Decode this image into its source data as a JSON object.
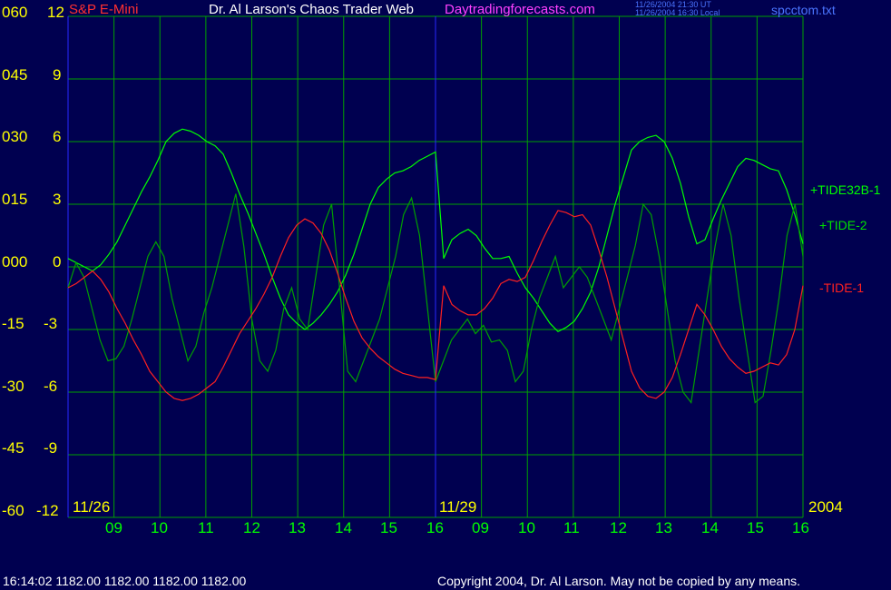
{
  "header": {
    "instrument": "S&P E-Mini",
    "site": "Dr. Al Larson's Chaos Trader Web",
    "domain": "Daytradingforecasts.com",
    "stamp_line1": "11/26/2004 21:30 UT",
    "stamp_line2": "11/26/2004 16:30 Local",
    "file": "spcctom.txt"
  },
  "footer": {
    "quote": "16:14:02  1182.00 1182.00 1182.00 1182.00",
    "copyright": "Copyright 2004, Dr. Al Larson. May not be copied by any means."
  },
  "colors": {
    "background": "#000050",
    "grid": "#00a000",
    "divider": "#2828ff",
    "axis_text": "#ffff00",
    "tide32b": "#00ff00",
    "tide2": "#00a000",
    "tide1": "#ff2020",
    "instrument": "#ff3030",
    "domain": "#ff40ff"
  },
  "chart_data": {
    "type": "line",
    "title": "S&P E-Mini",
    "left_axis": {
      "ticks": [
        "060",
        "045",
        "030",
        "015",
        "000",
        "-15",
        "-30",
        "-45",
        "-60"
      ],
      "ylim": [
        -60,
        60
      ]
    },
    "right_axis": {
      "ticks": [
        "12",
        "9",
        "6",
        "3",
        "0",
        "-3",
        "-6",
        "-9",
        "-12"
      ],
      "ylim": [
        -12,
        12
      ]
    },
    "x": {
      "hour_labels": [
        "09",
        "10",
        "11",
        "12",
        "13",
        "14",
        "15",
        "16",
        "09",
        "10",
        "11",
        "12",
        "13",
        "14",
        "15",
        "16"
      ],
      "date_labels": [
        "11/26",
        "11/29",
        "2004"
      ]
    },
    "series": [
      {
        "name": "+TIDE32B-1",
        "values": [
          0.4,
          0.2,
          0,
          -0.2,
          0.1,
          0.6,
          1.2,
          2,
          2.8,
          3.6,
          4.3,
          5.1,
          6,
          6.4,
          6.6,
          6.5,
          6.3,
          6.0,
          5.8,
          5.4,
          4.5,
          3.5,
          2.6,
          1.6,
          0.6,
          -0.5,
          -1.5,
          -2.3,
          -2.7,
          -3.0,
          -2.7,
          -2.3,
          -1.8,
          -1.2,
          -0.4,
          0.6,
          1.8,
          3,
          3.8,
          4.2,
          4.5,
          4.6,
          4.8,
          5.1,
          5.3,
          5.5,
          0.4,
          1.3,
          1.6,
          1.8,
          1.5,
          0.9,
          0.4,
          0.4,
          0.5,
          -0.3,
          -1,
          -1.5,
          -2.1,
          -2.7,
          -3.1,
          -2.9,
          -2.6,
          -2.0,
          -1.2,
          0,
          1.5,
          3,
          4.3,
          5.6,
          6.0,
          6.2,
          6.3,
          6.0,
          5.2,
          4.0,
          2.4,
          1.1,
          1.3,
          2.3,
          3.2,
          4.0,
          4.8,
          5.2,
          5.1,
          4.9,
          4.7,
          4.6,
          3.7,
          2.5,
          1.1
        ]
      },
      {
        "name": "+TIDE-2",
        "values": [
          -1,
          0.2,
          -0.5,
          -2,
          -3.5,
          -4.5,
          -4.4,
          -3.8,
          -2.5,
          -1,
          0.5,
          1.2,
          0.5,
          -1.5,
          -3,
          -4.5,
          -3.8,
          -2.2,
          -1,
          0.5,
          2,
          3.5,
          1,
          -2.5,
          -4.5,
          -5.0,
          -4.0,
          -2.0,
          -1.0,
          -2.5,
          -3.0,
          -0.5,
          2.0,
          3.0,
          -1.0,
          -5.0,
          -5.5,
          -4.5,
          -3.5,
          -2.5,
          -1,
          0.5,
          2.5,
          3.3,
          1.5,
          -2.0,
          -5.5,
          -4.5,
          -3.5,
          -3,
          -2.5,
          -3.2,
          -2.8,
          -3.6,
          -3.5,
          -4.0,
          -5.5,
          -5.0,
          -3.0,
          -1.5,
          -0.5,
          0.5,
          -1.0,
          -0.5,
          0,
          -0.5,
          -1.5,
          -2.5,
          -3.5,
          -2.0,
          -0.5,
          1.0,
          3.0,
          2.5,
          0.5,
          -2.0,
          -4.5,
          -6.0,
          -6.5,
          -4.0,
          -1.5,
          1.0,
          3.0,
          1.5,
          -1.5,
          -4.0,
          -6.5,
          -6.2,
          -4.0,
          -1.5,
          1.5,
          3.0,
          0.5
        ]
      },
      {
        "name": "-TIDE-1",
        "values": [
          -1.0,
          -0.8,
          -0.5,
          -0.2,
          -0.6,
          -1.2,
          -2.0,
          -2.7,
          -3.5,
          -4.2,
          -5.0,
          -5.5,
          -6.0,
          -6.3,
          -6.4,
          -6.3,
          -6.1,
          -5.8,
          -5.5,
          -4.8,
          -4.0,
          -3.2,
          -2.6,
          -2.0,
          -1.3,
          -0.5,
          0.5,
          1.4,
          2.0,
          2.3,
          2.1,
          1.6,
          0.8,
          -0.3,
          -1.5,
          -2.6,
          -3.4,
          -3.9,
          -4.3,
          -4.6,
          -4.9,
          -5.1,
          -5.2,
          -5.3,
          -5.3,
          -5.4,
          -0.9,
          -1.8,
          -2.1,
          -2.3,
          -2.3,
          -2.0,
          -1.5,
          -0.8,
          -0.6,
          -0.7,
          -0.5,
          0.3,
          1.2,
          2.0,
          2.7,
          2.6,
          2.4,
          2.5,
          2.0,
          0.8,
          -0.5,
          -2.0,
          -3.5,
          -5.0,
          -5.8,
          -6.2,
          -6.3,
          -6.0,
          -5.3,
          -4.2,
          -3.0,
          -1.8,
          -2.3,
          -3.0,
          -3.8,
          -4.4,
          -4.8,
          -5.1,
          -5.0,
          -4.8,
          -4.6,
          -4.7,
          -4.2,
          -3.0,
          -0.9
        ]
      }
    ],
    "legend": [
      "+TIDE32B-1",
      "+TIDE-2",
      "-TIDE-1"
    ]
  }
}
